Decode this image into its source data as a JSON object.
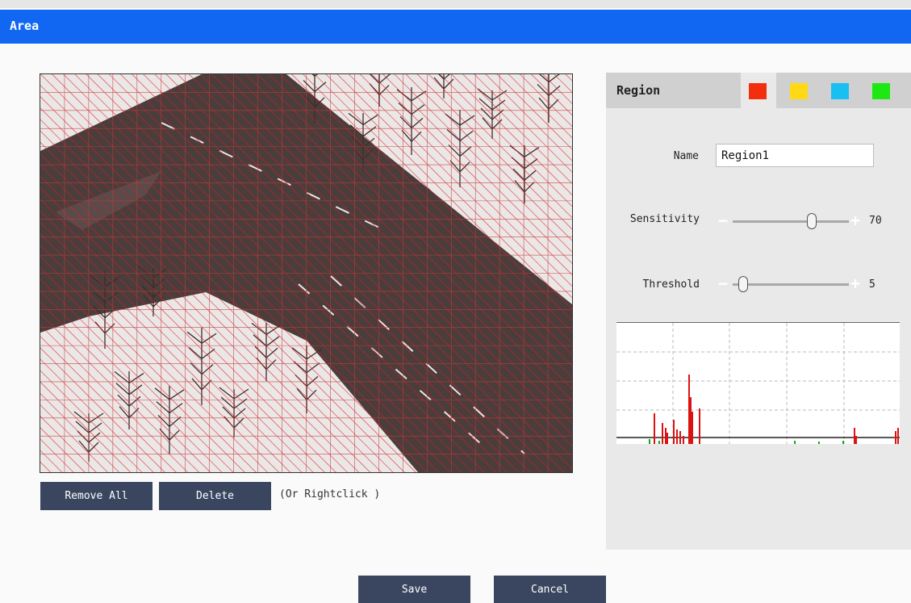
{
  "header": {
    "title": "Area"
  },
  "actions": {
    "remove_all_label": "Remove All",
    "delete_label": "Delete",
    "hint": "(Or Rightclick )"
  },
  "footer": {
    "save_label": "Save",
    "cancel_label": "Cancel"
  },
  "panel": {
    "title": "Region",
    "colors": [
      "#f22e0e",
      "#ffd916",
      "#19bff2",
      "#1ee811"
    ],
    "selected_color_index": 0,
    "name_label": "Name",
    "name_value": "Region1",
    "sensitivity_label": "Sensitivity",
    "sensitivity_value": "70",
    "sensitivity_fraction": 0.7,
    "threshold_label": "Threshold",
    "threshold_value": "5",
    "threshold_fraction": 0.05
  },
  "icons": {
    "minus": "−",
    "plus": "+"
  }
}
